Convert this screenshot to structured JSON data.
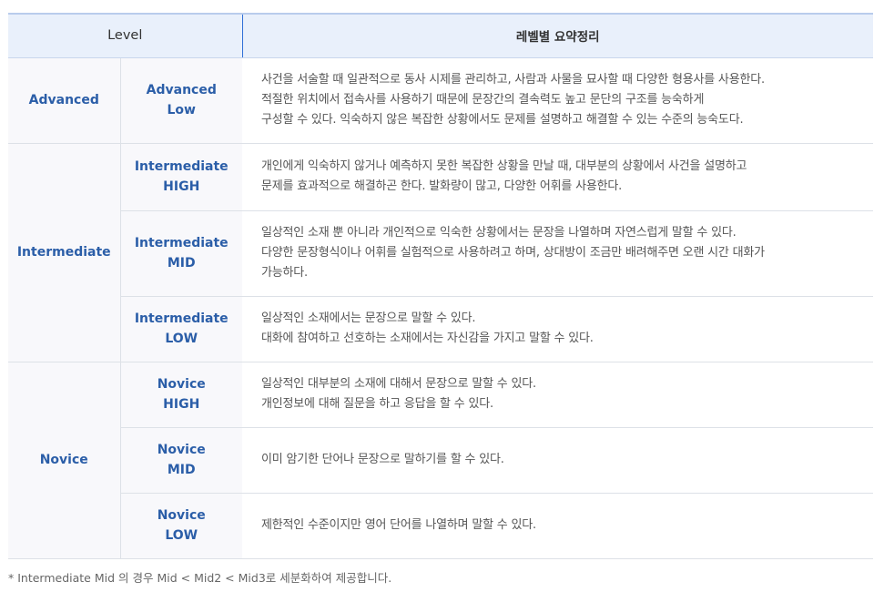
{
  "header": {
    "level": "Level",
    "summary": "레벨별 요약정리"
  },
  "rows": [
    {
      "group": "Advanced",
      "sub": [
        "Advanced",
        "Low"
      ],
      "desc": [
        "사건을 서술할 때 일관적으로 동사 시제를 관리하고, 사람과 사물을 묘사할 때 다양한 형용사를 사용한다.",
        "적절한 위치에서 접속사를 사용하기 때문에 문장간의 결속력도 높고 문단의 구조를 능숙하게",
        "구성할 수 있다. 익숙하지 않은 복잡한 상황에서도 문제를 설명하고 해결할 수 있는 수준의 능숙도다."
      ]
    },
    {
      "group": "Intermediate",
      "sub": [
        "Intermediate",
        "HIGH"
      ],
      "desc": [
        "개인에게 익숙하지 않거나 예측하지 못한 복잡한 상황을 만날 때, 대부분의 상황에서 사건을 설명하고",
        "문제를 효과적으로 해결하곤 한다. 발화량이 많고, 다양한 어휘를 사용한다."
      ]
    },
    {
      "sub": [
        "Intermediate",
        "MID"
      ],
      "desc": [
        "일상적인 소재 뿐 아니라 개인적으로 익숙한 상황에서는 문장을 나열하며 자연스럽게 말할 수 있다.",
        "다양한 문장형식이나 어휘를 실험적으로 사용하려고 하며, 상대방이 조금만 배려해주면 오랜 시간 대화가",
        "가능하다."
      ]
    },
    {
      "sub": [
        "Intermediate",
        "LOW"
      ],
      "desc": [
        "일상적인 소재에서는 문장으로 말할 수 있다.",
        "대화에 참여하고 선호하는 소재에서는 자신감을 가지고 말할 수 있다."
      ]
    },
    {
      "group": "Novice",
      "sub": [
        "Novice",
        "HIGH"
      ],
      "desc": [
        "일상적인 대부분의 소재에 대해서 문장으로 말할 수 있다.",
        "개인정보에 대해 질문을 하고 응답을 할 수 있다."
      ]
    },
    {
      "sub": [
        "Novice",
        "MID"
      ],
      "desc": [
        "이미 암기한 단어나 문장으로 말하기를 할 수 있다."
      ]
    },
    {
      "sub": [
        "Novice",
        "LOW"
      ],
      "desc": [
        "제한적인 수준이지만 영어 단어를 나열하며 말할 수 있다."
      ]
    }
  ],
  "footnote": "* Intermediate Mid 의 경우 Mid < Mid2 < Mid3로 세분화하여 제공합니다."
}
